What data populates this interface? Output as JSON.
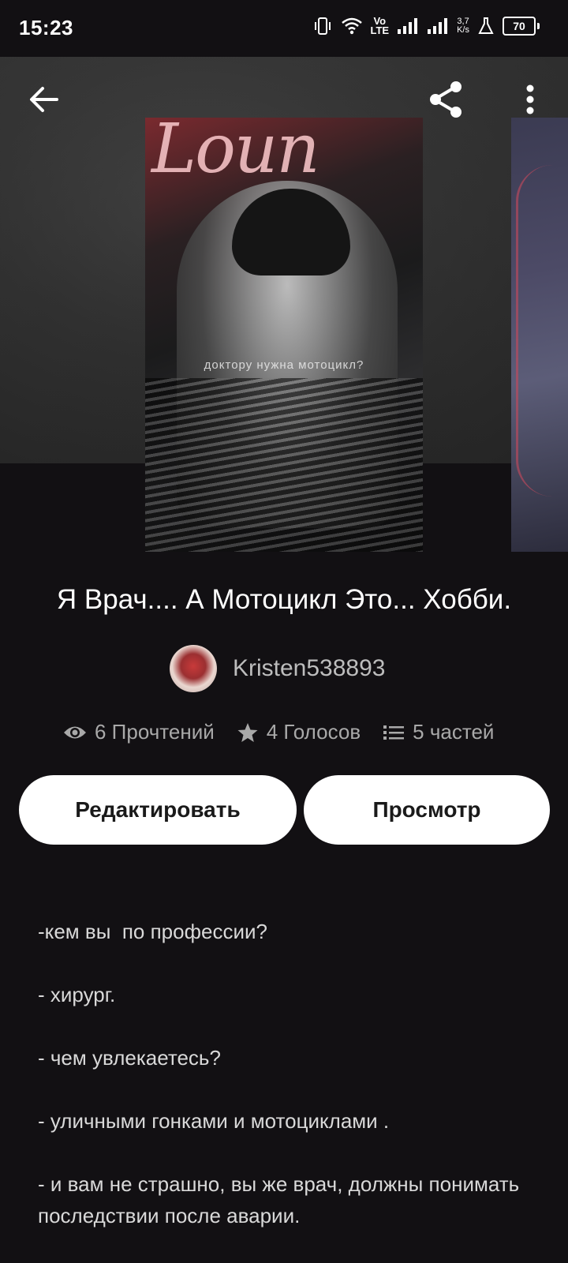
{
  "status_bar": {
    "time": "15:23",
    "network_label_top": "Vo",
    "network_label_bottom": "LTE",
    "speed_top": "3,7",
    "speed_bottom": "K/s",
    "battery": "70"
  },
  "toolbar": {
    "back_icon": "arrow-left-icon",
    "share_icon": "share-icon",
    "more_icon": "more-vertical-icon"
  },
  "cover": {
    "script_text": "Loun",
    "subtitle_text": "доктору нужна мотоцикл?"
  },
  "story": {
    "title": "Я Врач.... А Мотоцикл Это... Хобби.",
    "author": "Kristen538893",
    "stats": {
      "reads": "6 Прочтений",
      "votes": "4 Голосов",
      "parts": "5 частей"
    },
    "buttons": {
      "edit": "Редактировать",
      "view": "Просмотр"
    },
    "description": [
      "-кем вы  по профессии?",
      "- хирург.",
      "- чем увлекаетесь?",
      "- уличными гонками и мотоциклами .",
      "- и вам не страшно, вы же врач, должны понимать последствии после аварии."
    ]
  },
  "colors": {
    "background": "#121013",
    "button_bg": "#ffffff",
    "muted_text": "#a9a9a9"
  }
}
